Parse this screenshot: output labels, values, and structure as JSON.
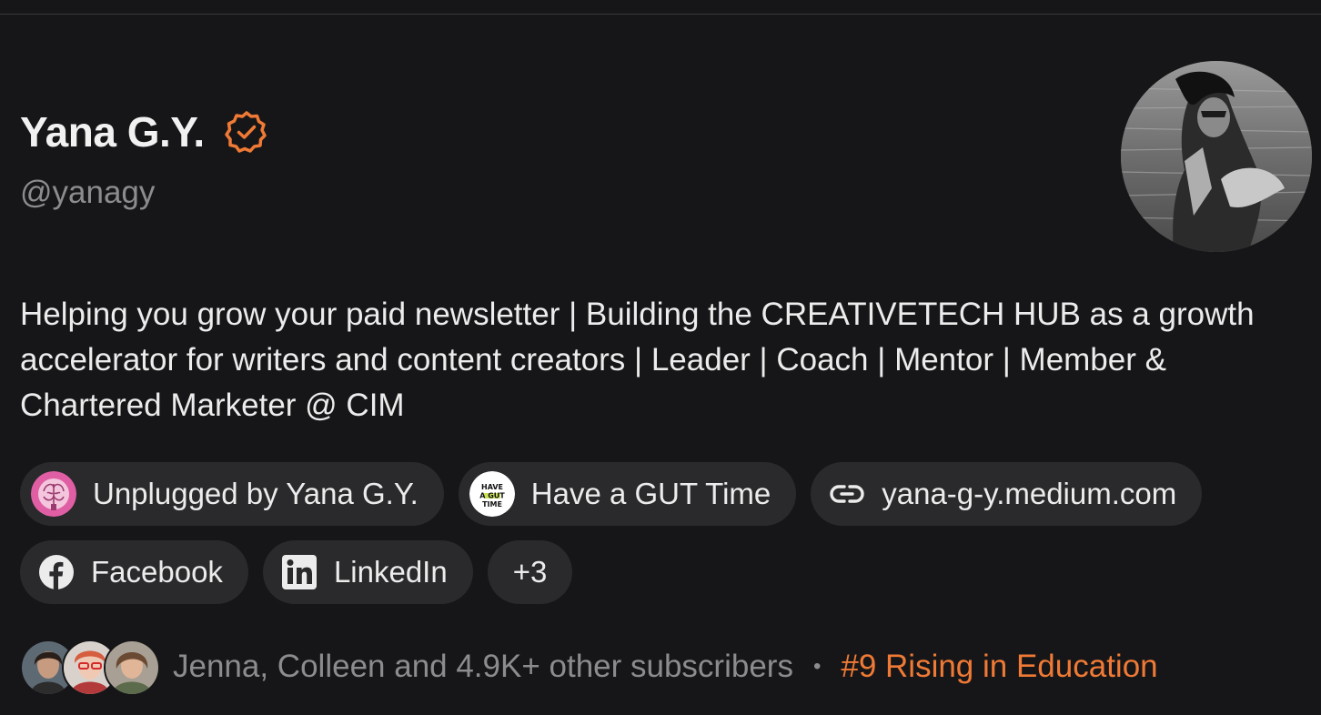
{
  "profile": {
    "name": "Yana G.Y.",
    "handle": "@yanagy",
    "bio": "Helping you grow your paid newsletter | Building the CREATIVETECH HUB as a growth accelerator for writers and content creators | Leader | Coach | Mentor | Member & Chartered Marketer @ CIM",
    "verified_icon": "verified-badge-icon",
    "accent_color": "#f07a35"
  },
  "links": [
    {
      "label": "Unplugged by Yana G.Y.",
      "icon": "brain-publication-logo"
    },
    {
      "label": "Have a GUT Time",
      "icon": "gut-time-publication-logo",
      "logo_text": "HAVE A GUT TIME"
    },
    {
      "label": "yana-g-y.medium.com",
      "icon": "link-icon"
    },
    {
      "label": "Facebook",
      "icon": "facebook-icon"
    },
    {
      "label": "LinkedIn",
      "icon": "linkedin-icon"
    },
    {
      "label": "+3"
    }
  ],
  "subscribers": {
    "text": "Jenna, Colleen and 4.9K+ other subscribers",
    "separator": "•",
    "rank": "#9 Rising in Education"
  }
}
